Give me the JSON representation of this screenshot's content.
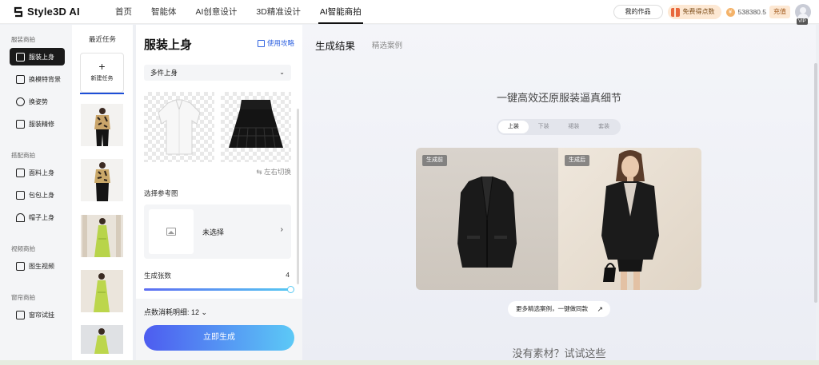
{
  "brand": {
    "name": "Style3D AI"
  },
  "nav": {
    "items": [
      {
        "label": "首页",
        "active": false
      },
      {
        "label": "智能体",
        "active": false
      },
      {
        "label": "AI创意设计",
        "active": false
      },
      {
        "label": "3D精准设计",
        "active": false
      },
      {
        "label": "AI智能商拍",
        "active": true
      }
    ]
  },
  "header_right": {
    "my_works": "我的作品",
    "free_points": "免费得点数",
    "points": "538380.5",
    "recharge": "充值",
    "vip": "VIP"
  },
  "sidebar": {
    "groups": [
      {
        "title": "服装商拍",
        "items": [
          {
            "label": "服装上身",
            "icon": "shirt-icon",
            "active": true
          },
          {
            "label": "换模特背景",
            "icon": "model-bg-icon",
            "active": false
          },
          {
            "label": "换姿势",
            "icon": "pose-icon",
            "active": false
          },
          {
            "label": "服装精修",
            "icon": "refine-icon",
            "active": false
          }
        ]
      },
      {
        "title": "搭配商拍",
        "items": [
          {
            "label": "面料上身",
            "icon": "fabric-icon",
            "active": false
          },
          {
            "label": "包包上身",
            "icon": "bag-icon",
            "active": false
          },
          {
            "label": "帽子上身",
            "icon": "hat-icon",
            "active": false
          }
        ]
      },
      {
        "title": "视频商拍",
        "items": [
          {
            "label": "图生视频",
            "icon": "video-icon",
            "active": false
          }
        ]
      },
      {
        "title": "窗帘商拍",
        "items": [
          {
            "label": "窗帘试挂",
            "icon": "curtain-icon",
            "active": false
          }
        ]
      }
    ]
  },
  "tasks": {
    "title": "最近任务",
    "new_task": "新建任务",
    "plus": "+"
  },
  "config": {
    "title": "服装上身",
    "guide": "使用攻略",
    "mode": "多件上身",
    "swap": "⇆ 左右切换",
    "ref_label": "选择参考图",
    "ref_value": "未选择",
    "count_label": "生成张数",
    "count_value": "4",
    "count_fraction": 1.0,
    "cost": "点数消耗明细: 12 ⌄",
    "generate": "立即生成"
  },
  "main": {
    "tab_result": "生成结果",
    "tab_cases": "精选案例",
    "headline": "一键高效还原服装逼真细节",
    "segments": [
      {
        "label": "上装",
        "active": true
      },
      {
        "label": "下装",
        "active": false
      },
      {
        "label": "裙装",
        "active": false
      },
      {
        "label": "套装",
        "active": false
      }
    ],
    "before_tag": "生成前",
    "after_tag": "生成后",
    "more_cases": "更多精选案例，一键做同款",
    "more_arrow": "↗",
    "no_material": "没有素材？试试这些"
  },
  "colors": {
    "accent_blue": "#2f62e0",
    "active_dark": "#1a1a1a",
    "gradient_start": "#4d5cf0",
    "gradient_end": "#5cc9f6"
  }
}
